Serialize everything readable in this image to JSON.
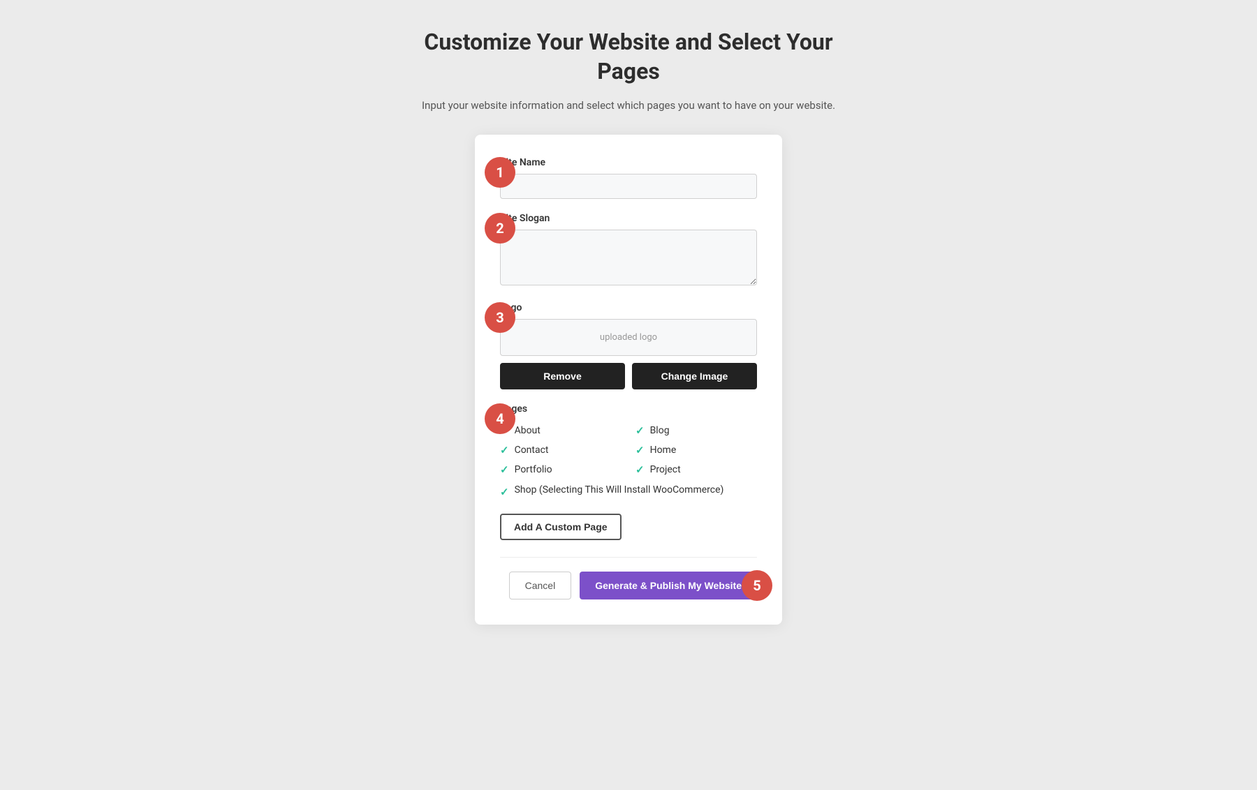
{
  "header": {
    "title": "Customize Your Website and Select Your Pages",
    "subtitle": "Input your website information and select which pages you want to have on your website."
  },
  "form": {
    "site_name_label": "Site Name",
    "site_name_placeholder": "",
    "site_slogan_label": "Site Slogan",
    "site_slogan_placeholder": "",
    "logo_label": "Logo",
    "logo_placeholder": "uploaded logo",
    "remove_label": "Remove",
    "change_image_label": "Change Image",
    "pages_label": "Pages",
    "pages": [
      {
        "label": "About",
        "checked": true,
        "column": 1
      },
      {
        "label": "Blog",
        "checked": true,
        "column": 2
      },
      {
        "label": "Contact",
        "checked": true,
        "column": 1
      },
      {
        "label": "Home",
        "checked": true,
        "column": 2
      },
      {
        "label": "Portfolio",
        "checked": true,
        "column": 1
      },
      {
        "label": "Project",
        "checked": true,
        "column": 2
      }
    ],
    "shop_page_label": "Shop (Selecting This Will Install WooCommerce)",
    "shop_checked": true,
    "add_custom_page_label": "Add A Custom Page",
    "cancel_label": "Cancel",
    "generate_label": "Generate & Publish My Website"
  },
  "steps": {
    "step1": "1",
    "step2": "2",
    "step3": "3",
    "step4": "4",
    "step5": "5"
  },
  "icons": {
    "check": "✓"
  }
}
